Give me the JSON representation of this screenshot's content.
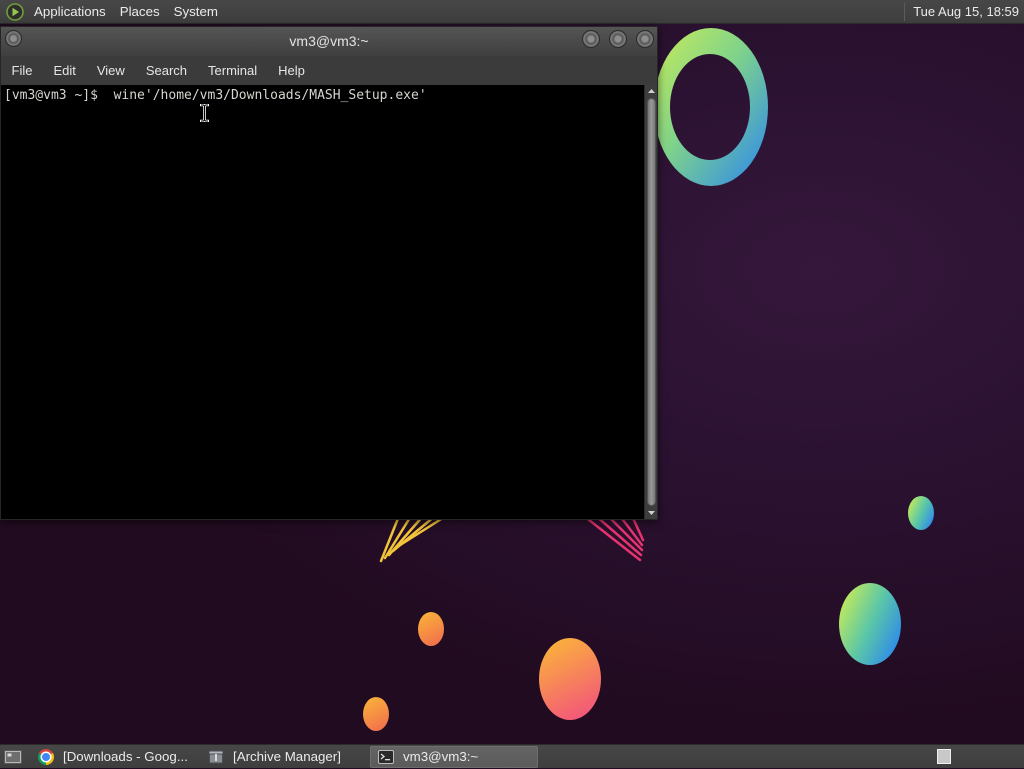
{
  "colors": {
    "desktop_background": "#2a1130",
    "panel_background": "#3e3e3e",
    "panel_text": "#ebebeb",
    "terminal_background": "#000000",
    "terminal_text": "#d3d7cf",
    "active_task_background": "#5b5b5b",
    "wallpaper_green": "#c9ec58",
    "wallpaper_blue": "#2a86f0",
    "wallpaper_orange": "#fbb13c",
    "wallpaper_pink": "#f2557a"
  },
  "top_panel": {
    "logo_icon": "mate-menu-icon",
    "menus": [
      "Applications",
      "Places",
      "System"
    ],
    "clock": "Tue Aug 15, 18:59"
  },
  "terminal_window": {
    "title": "vm3@vm3:~",
    "menubar": [
      "File",
      "Edit",
      "View",
      "Search",
      "Terminal",
      "Help"
    ],
    "lines": [
      {
        "prompt": "[vm3@vm3 ~]$",
        "command": "wine'/home/vm3/Downloads/MASH_Setup.exe'"
      }
    ]
  },
  "taskbar": {
    "show_desktop_icon": "show-desktop-icon",
    "items": [
      {
        "label": "[Downloads - Goog...",
        "icon": "chrome-icon",
        "active": false
      },
      {
        "label": "[Archive Manager]",
        "icon": "archive-manager-icon",
        "active": false
      },
      {
        "label": "vm3@vm3:~",
        "icon": "terminal-icon",
        "active": true
      }
    ]
  }
}
